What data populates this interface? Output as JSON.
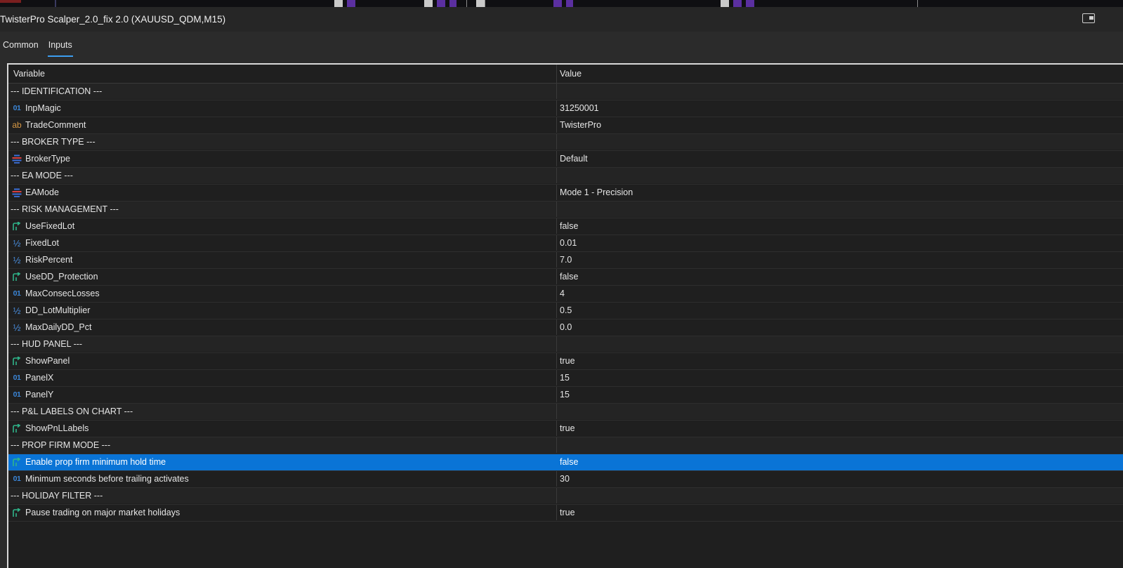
{
  "window": {
    "title": "TwisterPro Scalper_2.0_fix 2.0 (XAUUSD_QDM,M15)"
  },
  "tabs": [
    {
      "label": "Common",
      "active": false
    },
    {
      "label": "Inputs",
      "active": true
    }
  ],
  "table": {
    "headers": {
      "variable": "Variable",
      "value": "Value"
    },
    "rows": [
      {
        "kind": "section",
        "variable": "--- IDENTIFICATION ---",
        "value": ""
      },
      {
        "kind": "param",
        "type": "int",
        "icon": "01",
        "variable": "InpMagic",
        "value": "31250001"
      },
      {
        "kind": "param",
        "type": "string",
        "icon": "ab",
        "variable": "TradeComment",
        "value": "TwisterPro"
      },
      {
        "kind": "section",
        "variable": "--- BROKER TYPE ---",
        "value": ""
      },
      {
        "kind": "param",
        "type": "enum",
        "variable": "BrokerType",
        "value": "Default"
      },
      {
        "kind": "section",
        "variable": "--- EA MODE ---",
        "value": ""
      },
      {
        "kind": "param",
        "type": "enum",
        "variable": "EAMode",
        "value": "Mode 1 - Precision"
      },
      {
        "kind": "section",
        "variable": "--- RISK MANAGEMENT ---",
        "value": ""
      },
      {
        "kind": "param",
        "type": "bool",
        "variable": "UseFixedLot",
        "value": "false"
      },
      {
        "kind": "param",
        "type": "double",
        "icon": "½",
        "variable": "FixedLot",
        "value": "0.01"
      },
      {
        "kind": "param",
        "type": "double",
        "icon": "½",
        "variable": "RiskPercent",
        "value": "7.0"
      },
      {
        "kind": "param",
        "type": "bool",
        "variable": "UseDD_Protection",
        "value": "false"
      },
      {
        "kind": "param",
        "type": "int",
        "icon": "01",
        "variable": "MaxConsecLosses",
        "value": "4"
      },
      {
        "kind": "param",
        "type": "double",
        "icon": "½",
        "variable": "DD_LotMultiplier",
        "value": "0.5"
      },
      {
        "kind": "param",
        "type": "double",
        "icon": "½",
        "variable": "MaxDailyDD_Pct",
        "value": "0.0"
      },
      {
        "kind": "section",
        "variable": "--- HUD PANEL ---",
        "value": ""
      },
      {
        "kind": "param",
        "type": "bool",
        "variable": "ShowPanel",
        "value": "true"
      },
      {
        "kind": "param",
        "type": "int",
        "icon": "01",
        "variable": "PanelX",
        "value": "15"
      },
      {
        "kind": "param",
        "type": "int",
        "icon": "01",
        "variable": "PanelY",
        "value": "15"
      },
      {
        "kind": "section",
        "variable": "--- P&L LABELS ON CHART ---",
        "value": ""
      },
      {
        "kind": "param",
        "type": "bool",
        "variable": "ShowPnLLabels",
        "value": "true"
      },
      {
        "kind": "section",
        "variable": "--- PROP FIRM MODE ---",
        "value": ""
      },
      {
        "kind": "param",
        "type": "bool",
        "variable": "Enable prop firm minimum hold time",
        "value": "false",
        "selected": true
      },
      {
        "kind": "param",
        "type": "int",
        "icon": "01",
        "variable": "Minimum seconds before trailing activates",
        "value": "30"
      },
      {
        "kind": "section",
        "variable": "--- HOLIDAY FILTER ---",
        "value": ""
      },
      {
        "kind": "param",
        "type": "bool",
        "variable": "Pause trading on major market holidays",
        "value": "true"
      }
    ]
  },
  "colors": {
    "selection": "#0a74d6",
    "tab_underline": "#3c9ef0",
    "bool_icon": "#2fb58a",
    "enum_icon_blue": "#3b6fd8",
    "enum_icon_red": "#d84040"
  }
}
